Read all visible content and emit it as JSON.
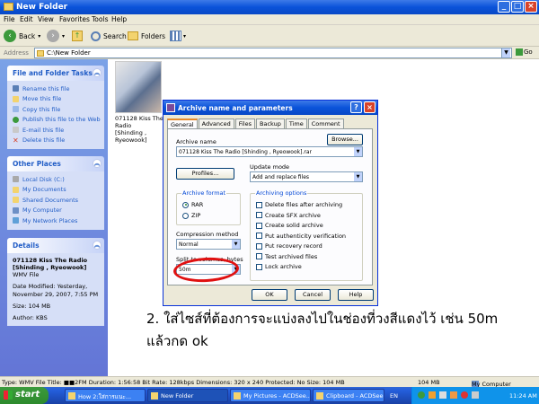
{
  "window": {
    "title": "New Folder"
  },
  "menu": [
    "File",
    "Edit",
    "View",
    "Favorites",
    "Tools",
    "Help"
  ],
  "toolbar": {
    "back": "Back",
    "search": "Search",
    "folders": "Folders"
  },
  "address": {
    "label": "Address",
    "path": "C:\\New Folder",
    "go": "Go"
  },
  "left_pane": {
    "file_tasks": {
      "title": "File and Folder Tasks",
      "items": [
        "Rename this file",
        "Move this file",
        "Copy this file",
        "Publish this file to the Web",
        "E-mail this file",
        "Delete this file"
      ]
    },
    "other_places": {
      "title": "Other Places",
      "items": [
        "Local Disk (C:)",
        "My Documents",
        "Shared Documents",
        "My Computer",
        "My Network Places"
      ]
    },
    "details": {
      "title": "Details",
      "name_line1": "071128 Kiss The Radio",
      "name_line2": "[Shinding , Ryeowook]",
      "type": "WMV File",
      "modified_line1": "Date Modified: Yesterday,",
      "modified_line2": "November 29, 2007, 7:55 PM",
      "size": "Size: 104 MB",
      "author": "Author: KBS"
    }
  },
  "file": {
    "caption_line1": "071128 Kiss The Radio",
    "caption_line2": "[Shinding , Ryeowook]"
  },
  "dialog": {
    "title": "Archive name and parameters",
    "help": "?",
    "close": "×",
    "tabs": [
      "General",
      "Advanced",
      "Files",
      "Backup",
      "Time",
      "Comment"
    ],
    "archive_name_label": "Archive name",
    "archive_name_value": "071128 Kiss The Radio [Shinding , Ryeowook].rar",
    "browse": "Browse...",
    "profiles": "Profiles...",
    "update_mode_label": "Update mode",
    "update_mode_value": "Add and replace files",
    "archive_format_label": "Archive format",
    "formats": [
      "RAR",
      "ZIP"
    ],
    "compression_label": "Compression method",
    "compression_value": "Normal",
    "split_label": "Split to volumes, bytes",
    "split_value": "50m",
    "archiving_options_label": "Archiving options",
    "options": [
      "Delete files after archiving",
      "Create SFX archive",
      "Create solid archive",
      "Put authenticity verification",
      "Put recovery record",
      "Test archived files",
      "Lock archive"
    ],
    "ok": "OK",
    "cancel": "Cancel",
    "help_btn": "Help"
  },
  "annotation": {
    "line1": "2. ใส่ไซส์ที่ต้องการจะแบ่งลงไปในช่องที่วงสีแดงไว้ เช่น 50m",
    "line2": "แล้วกด ok"
  },
  "statusbar": {
    "info": "Type: WMV File Title: ■■2FM Duration: 1:56:58 Bit Rate: 128kbps Dimensions: 320 x 240 Protected: No Size: 104 MB",
    "size": "104 MB",
    "location": "My Computer"
  },
  "taskbar": {
    "start": "start",
    "tasks": [
      "How 2:ใส่การแนะ...",
      "New Folder",
      "My Pictures - ACDSee...",
      "Clipboard - ACDSee..."
    ],
    "lang": "EN",
    "clock": "11:24 AM"
  },
  "colors": {
    "annotation_circle": "#e01010",
    "xp_blue": "#0a53d9"
  }
}
